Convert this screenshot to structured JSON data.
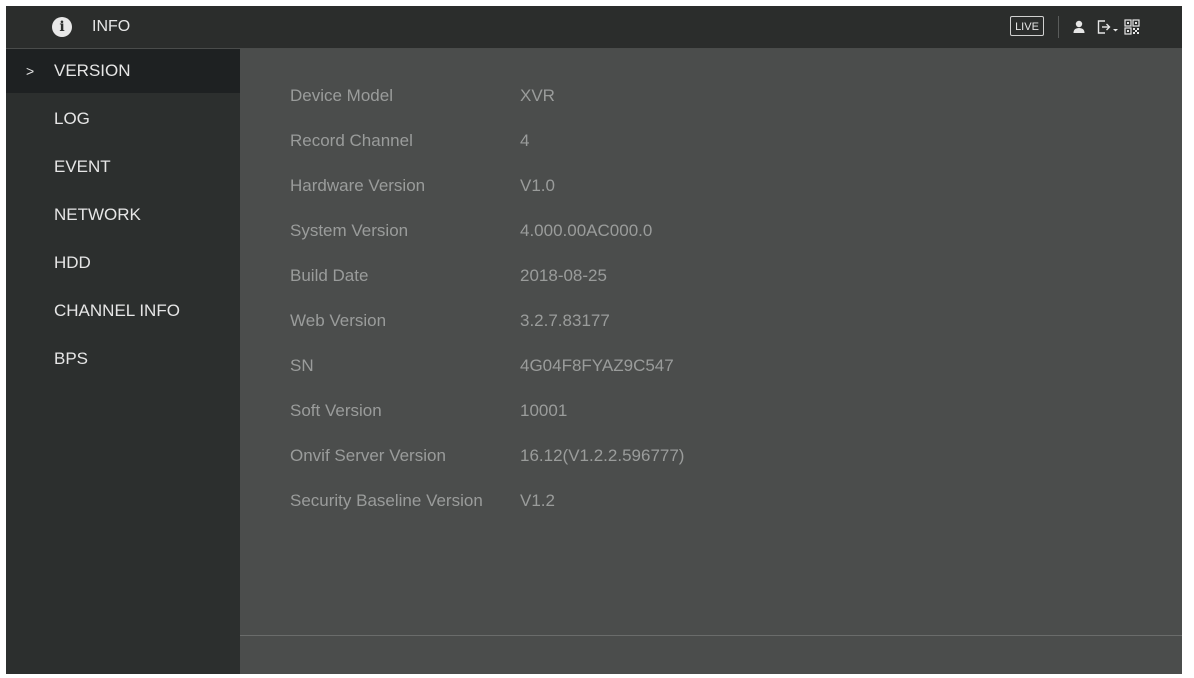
{
  "header": {
    "title": "INFO",
    "title_icon": "info-icon",
    "live_label": "LIVE",
    "icons": [
      "user-icon",
      "logout-icon",
      "qr-code-icon"
    ]
  },
  "sidebar": {
    "active_indicator": ">",
    "items": [
      {
        "label": "VERSION",
        "active": true
      },
      {
        "label": "LOG",
        "active": false
      },
      {
        "label": "EVENT",
        "active": false
      },
      {
        "label": "NETWORK",
        "active": false
      },
      {
        "label": "HDD",
        "active": false
      },
      {
        "label": "CHANNEL INFO",
        "active": false
      },
      {
        "label": "BPS",
        "active": false
      }
    ]
  },
  "version_info": [
    {
      "label": "Device Model",
      "value": "XVR"
    },
    {
      "label": "Record Channel",
      "value": "4"
    },
    {
      "label": "Hardware Version",
      "value": "V1.0"
    },
    {
      "label": "System Version",
      "value": "4.000.00AC000.0"
    },
    {
      "label": "Build Date",
      "value": "2018-08-25"
    },
    {
      "label": "Web Version",
      "value": "3.2.7.83177"
    },
    {
      "label": "SN",
      "value": "4G04F8FYAZ9C547"
    },
    {
      "label": "Soft Version",
      "value": "10001"
    },
    {
      "label": "Onvif Server Version",
      "value": "16.12(V1.2.2.596777)"
    },
    {
      "label": "Security Baseline Version",
      "value": "V1.2"
    }
  ],
  "colors": {
    "titlebar": "#2b2d2c",
    "sidebar": "#2c2f2e",
    "sidebar_active": "#1e2122",
    "main": "#4b4d4c",
    "text": "#e6e6e6",
    "muted_text": "#9a9c9b"
  }
}
